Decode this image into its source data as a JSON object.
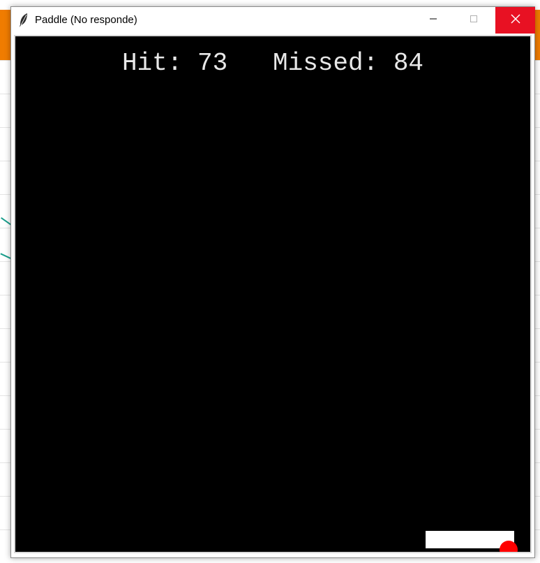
{
  "window": {
    "title": "Paddle (No responde)",
    "app_icon": "feather-icon",
    "controls": {
      "minimize_icon": "minimize-icon",
      "maximize_icon": "maximize-icon",
      "close_icon": "close-icon"
    }
  },
  "game": {
    "score_text": "Hit: 73   Missed: 84",
    "hit_label": "Hit:",
    "hit_value": 73,
    "missed_label": "Missed:",
    "missed_value": 84
  },
  "colors": {
    "canvas_background": "#000000",
    "paddle": "#ffffff",
    "ball": "#ff0000",
    "score_text": "#e8e8e8",
    "close_button": "#e81123"
  }
}
